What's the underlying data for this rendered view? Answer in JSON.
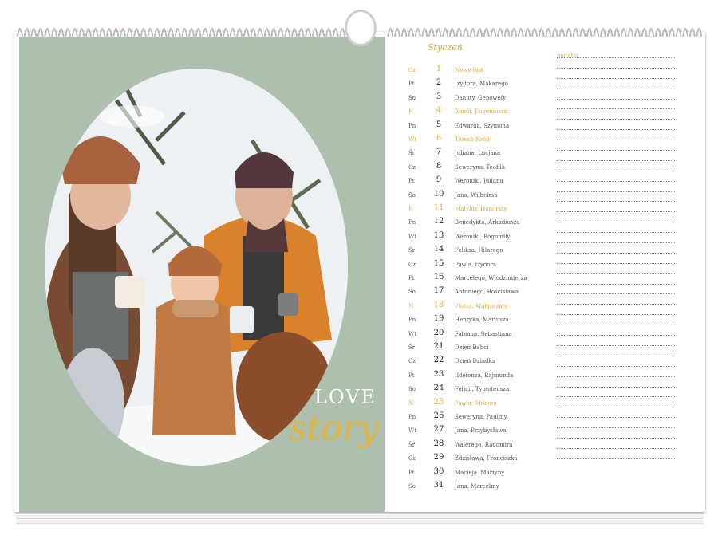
{
  "photo": {
    "title_word1": "LOVE",
    "title_word2": "story",
    "accent_color": "#e3b43e",
    "background_color": "#adbfad"
  },
  "calendar": {
    "month": "Styczeń",
    "notes_label": "notatki",
    "sunday_color": "#e0a93a",
    "days": [
      {
        "dn": "Cz",
        "num": "1",
        "name": "Nowy Rok",
        "sunday": true
      },
      {
        "dn": "Pt",
        "num": "2",
        "name": "Izydora, Makarego",
        "sunday": false
      },
      {
        "dn": "So",
        "num": "3",
        "name": "Danuty, Genowefy",
        "sunday": false
      },
      {
        "dn": "N",
        "num": "4",
        "name": "Anieli, Eugeniusza",
        "sunday": true
      },
      {
        "dn": "Pn",
        "num": "5",
        "name": "Edwarda, Szymona",
        "sunday": false
      },
      {
        "dn": "Wt",
        "num": "6",
        "name": "Trzech Króli",
        "sunday": true
      },
      {
        "dn": "Śr",
        "num": "7",
        "name": "Juliana, Lucjana",
        "sunday": false
      },
      {
        "dn": "Cz",
        "num": "8",
        "name": "Seweryna, Teofila",
        "sunday": false
      },
      {
        "dn": "Pt",
        "num": "9",
        "name": "Weroniki, Juliana",
        "sunday": false
      },
      {
        "dn": "So",
        "num": "10",
        "name": "Jana, Wilhelma",
        "sunday": false
      },
      {
        "dn": "N",
        "num": "11",
        "name": "Matyldy, Honoraty",
        "sunday": true
      },
      {
        "dn": "Pn",
        "num": "12",
        "name": "Benedykta, Arkadiusza",
        "sunday": false
      },
      {
        "dn": "Wt",
        "num": "13",
        "name": "Weroniki, Bogumiły",
        "sunday": false
      },
      {
        "dn": "Śr",
        "num": "14",
        "name": "Feliksa, Hilarego",
        "sunday": false
      },
      {
        "dn": "Cz",
        "num": "15",
        "name": "Pawła, Izydora",
        "sunday": false
      },
      {
        "dn": "Pt",
        "num": "16",
        "name": "Marcelego, Włodzimierza",
        "sunday": false
      },
      {
        "dn": "So",
        "num": "17",
        "name": "Antoniego, Rościsława",
        "sunday": false
      },
      {
        "dn": "N",
        "num": "18",
        "name": "Piotra, Małgorzaty",
        "sunday": true
      },
      {
        "dn": "Pn",
        "num": "19",
        "name": "Henryka, Mariusza",
        "sunday": false
      },
      {
        "dn": "Wt",
        "num": "20",
        "name": "Fabiana, Sebastiana",
        "sunday": false
      },
      {
        "dn": "Śr",
        "num": "21",
        "name": "Dzień Babci",
        "sunday": false
      },
      {
        "dn": "Cz",
        "num": "22",
        "name": "Dzień Dziadka",
        "sunday": false
      },
      {
        "dn": "Pt",
        "num": "23",
        "name": "Ildefonsa, Rajmunda",
        "sunday": false
      },
      {
        "dn": "So",
        "num": "24",
        "name": "Felicji, Tymoteusza",
        "sunday": false
      },
      {
        "dn": "N",
        "num": "25",
        "name": "Pawła, Miłosza",
        "sunday": true
      },
      {
        "dn": "Pn",
        "num": "26",
        "name": "Seweryna, Pauliny",
        "sunday": false
      },
      {
        "dn": "Wt",
        "num": "27",
        "name": "Jana, Przybysława",
        "sunday": false
      },
      {
        "dn": "Śr",
        "num": "28",
        "name": "Walerego, Radomira",
        "sunday": false
      },
      {
        "dn": "Cz",
        "num": "29",
        "name": "Zdzisława, Franciszka",
        "sunday": false
      },
      {
        "dn": "Pt",
        "num": "30",
        "name": "Macieja, Martyny",
        "sunday": false
      },
      {
        "dn": "So",
        "num": "31",
        "name": "Jana, Marcelmy",
        "sunday": false
      }
    ]
  }
}
